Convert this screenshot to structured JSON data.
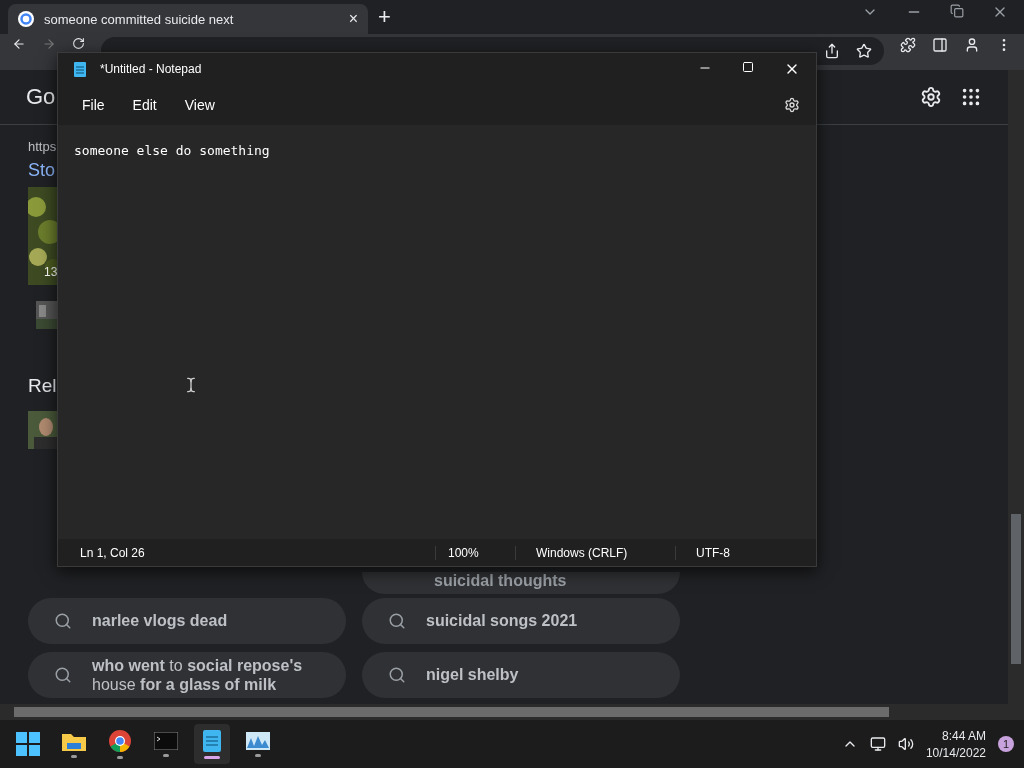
{
  "browser": {
    "tab": {
      "title": "someone committed suicide next",
      "close": "×"
    },
    "new_tab": "+",
    "page": {
      "logo": "Go",
      "link_url": "https",
      "section_title": "Sto",
      "video_time": "13",
      "related_title": "Rel",
      "related_searches": [
        {
          "kind": "partial",
          "text": "suicidal thoughts"
        },
        {
          "kind": "full",
          "text": "narlee vlogs dead"
        },
        {
          "kind": "full",
          "text": "suicidal songs 2021"
        },
        {
          "kind": "full",
          "text": "**who went** to **social repose's** house **for a glass of milk**"
        },
        {
          "kind": "full",
          "text": "nigel shelby"
        }
      ]
    }
  },
  "notepad": {
    "title": "*Untitled - Notepad",
    "menu": [
      "File",
      "Edit",
      "View"
    ],
    "content": "someone else do something",
    "status_bar": [
      "Ln 1, Col 26",
      "100%",
      "Windows (CRLF)",
      "UTF-8"
    ]
  },
  "taskbar": {
    "apps": [
      {
        "kind": "start",
        "selected": false
      },
      {
        "kind": "folder",
        "selected": false
      },
      {
        "kind": "chrome",
        "selected": false
      },
      {
        "kind": "terminal",
        "selected": false
      },
      {
        "kind": "notepad",
        "selected": true
      },
      {
        "kind": "monitor",
        "selected": false
      }
    ],
    "time": "8:44 AM",
    "date": "10/14/2022",
    "notifications": "1"
  }
}
